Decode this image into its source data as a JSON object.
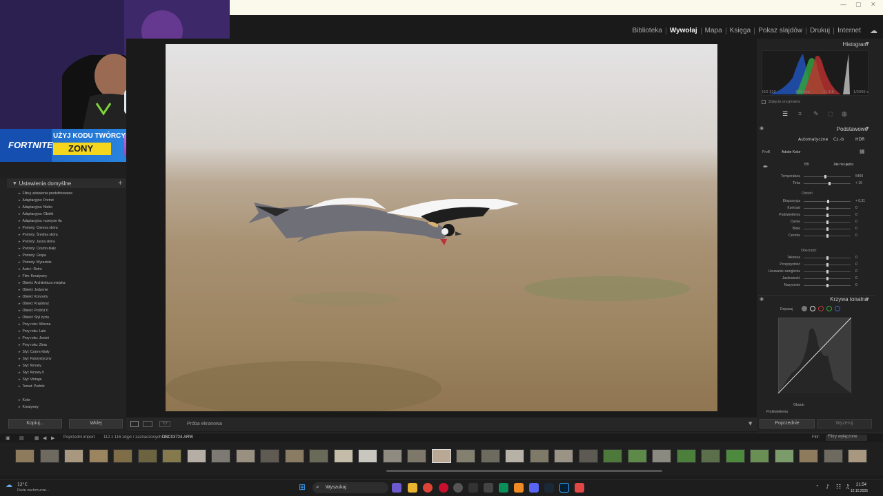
{
  "window": {
    "controls": [
      "—",
      "▢",
      "✕"
    ]
  },
  "modules": [
    {
      "label": "Biblioteka",
      "active": false
    },
    {
      "label": "Wywołaj",
      "active": true
    },
    {
      "label": "Mapa",
      "active": false
    },
    {
      "label": "Księga",
      "active": false
    },
    {
      "label": "Pokaz slajdów",
      "active": false
    },
    {
      "label": "Drukuj",
      "active": false
    },
    {
      "label": "Internet",
      "active": false
    }
  ],
  "banner": {
    "game": "FORTNITE",
    "line1": "UŻYJ KODU TWÓRCY",
    "code": "ZONY"
  },
  "left_panel": {
    "header": "Ustawienia domyślne",
    "add": "+",
    "items": [
      "Filtruj ustawienia predefiniowane",
      "Adaptacyjna: Portret",
      "Adaptacyjna: Niebo",
      "Adaptacyjna: Obiekt",
      "Adaptacyjna: rozmycie tła",
      "Portrety: Ciemna skóra",
      "Portrety: Średnia skóra",
      "Portrety: Jasna skóra",
      "Portrety: Czarno-biały",
      "Portrety: Grupa",
      "Portrety: Wyraziste",
      "Auto+: Retro",
      "Film: Kreatywny",
      "Obiekt: Architektura miejska",
      "Obiekt: Jedzenie",
      "Obiekt: Koncerty",
      "Obiekt: Krajobraz",
      "Obiekt: Podróż II",
      "Obiekt: Styl życia",
      "Pory roku: Wiosna",
      "Pory roku: Lato",
      "Pory roku: Jesień",
      "Pory roku: Zima",
      "Styl: Czarno-biały",
      "Styl: Futurystyczny",
      "Styl: Kinowy",
      "Styl: Kinowy II",
      "Styl: Vintage",
      "Temat: Podróż",
      "",
      "Kolor",
      "Kreatywny"
    ],
    "copy_button": "Kopiuj...",
    "paste_button": "Wklej"
  },
  "toolbar": {
    "softproof": "Próba ekranowa"
  },
  "right_panel": {
    "histogram_title": "Histogram",
    "hist_info": [
      "ISO 320",
      "400 mm",
      "f / 2,8",
      "1/2000 s"
    ],
    "original_photo": "Zdjęcie oryginalne",
    "basic_title": "Podstawowe",
    "auto_btn": "Automatyczne",
    "bw_btn": "Cz.-b",
    "hdr_btn": "HDR",
    "profile_label": "Profil",
    "profile_value": "Adobe Kolor",
    "wb_label": "BB",
    "wb_value": "Jak na ujęciu",
    "sliders_wb": [
      {
        "label": "Temperatura",
        "value": "5400",
        "pos": 0.45
      },
      {
        "label": "Tinta",
        "value": "+ 16",
        "pos": 0.55
      }
    ],
    "tone_title": "Odcień",
    "sliders_tone": [
      {
        "label": "Ekspozycja",
        "value": "+ 0,31",
        "pos": 0.52
      },
      {
        "label": "Kontrast",
        "value": "0",
        "pos": 0.5
      },
      {
        "label": "Podświetlenia",
        "value": "0",
        "pos": 0.5
      },
      {
        "label": "Cienie",
        "value": "0",
        "pos": 0.5
      },
      {
        "label": "Biele",
        "value": "0",
        "pos": 0.5
      },
      {
        "label": "Czernie",
        "value": "0",
        "pos": 0.5
      }
    ],
    "presence_title": "Obecność",
    "sliders_presence": [
      {
        "label": "Tekstura",
        "value": "0",
        "pos": 0.5
      },
      {
        "label": "Przejrzystość",
        "value": "0",
        "pos": 0.5
      },
      {
        "label": "Usuwanie zamglenia",
        "value": "0",
        "pos": 0.5
      },
      {
        "label": "Jaskrawość",
        "value": "0",
        "pos": 0.5
      },
      {
        "label": "Nasycenie",
        "value": "0",
        "pos": 0.5
      }
    ],
    "curve_title": "Krzywa tonalna",
    "curve_label": "Dopasuj",
    "curve_region": "Obszar",
    "curve_highlights": "Podświetlenia",
    "prev_button": "Poprzednie",
    "reset_button": "Wyzeruj"
  },
  "filmbar": {
    "source": "Poprzedni import",
    "count": "112 z 116 zdjęć / zaznaczonych: 1 /",
    "filename": "DSC03724.ARW",
    "filter_label": "Filtr:",
    "filter_value": "Filtry wyłączone"
  },
  "taskbar": {
    "weather_temp": "12°C",
    "weather_desc": "Duże zachmurze...",
    "search": "Wyszukaj",
    "time": "21:54",
    "date": "12.10.2025"
  },
  "colors": {
    "accent": "#c8c8c8",
    "panel": "#222222",
    "taskbar": "#1d1d1d"
  }
}
